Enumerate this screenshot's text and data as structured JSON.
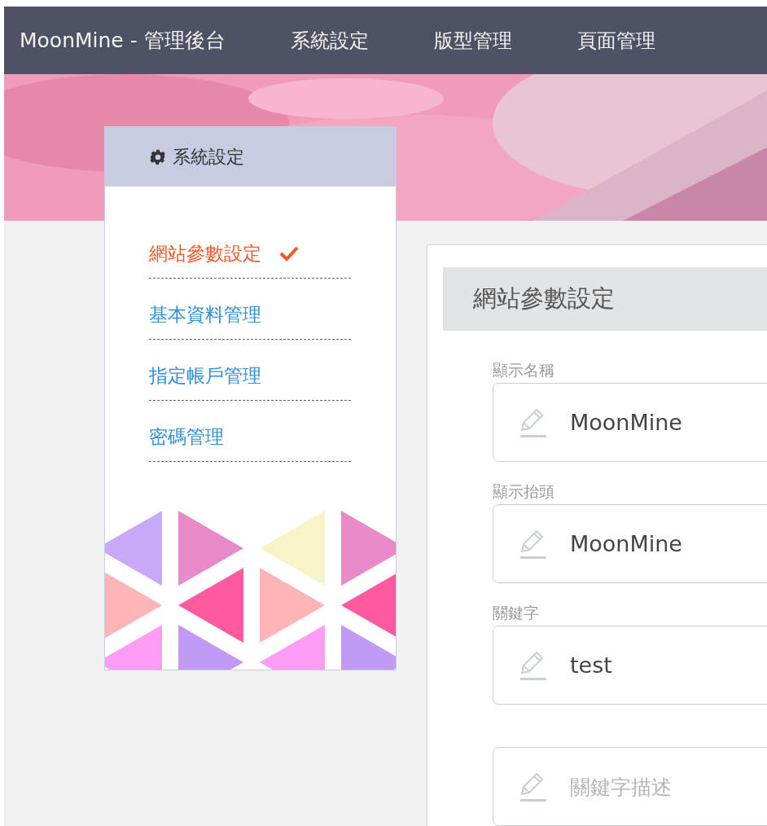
{
  "nav": {
    "brand": "MoonMine - 管理後台",
    "items": [
      "系統設定",
      "版型管理",
      "頁面管理"
    ]
  },
  "sidebar": {
    "title": "系統設定",
    "items": [
      {
        "label": "網站參數設定",
        "selected": true
      },
      {
        "label": "基本資料管理",
        "selected": false
      },
      {
        "label": "指定帳戶管理",
        "selected": false
      },
      {
        "label": "密碼管理",
        "selected": false
      }
    ]
  },
  "content": {
    "title": "網站參數設定",
    "fields": [
      {
        "label": "顯示名稱",
        "value": "MoonMine"
      },
      {
        "label": "顯示抬頭",
        "value": "MoonMine"
      },
      {
        "label": "關鍵字",
        "value": "test"
      },
      {
        "placeholder": "關鍵字描述"
      }
    ]
  }
}
